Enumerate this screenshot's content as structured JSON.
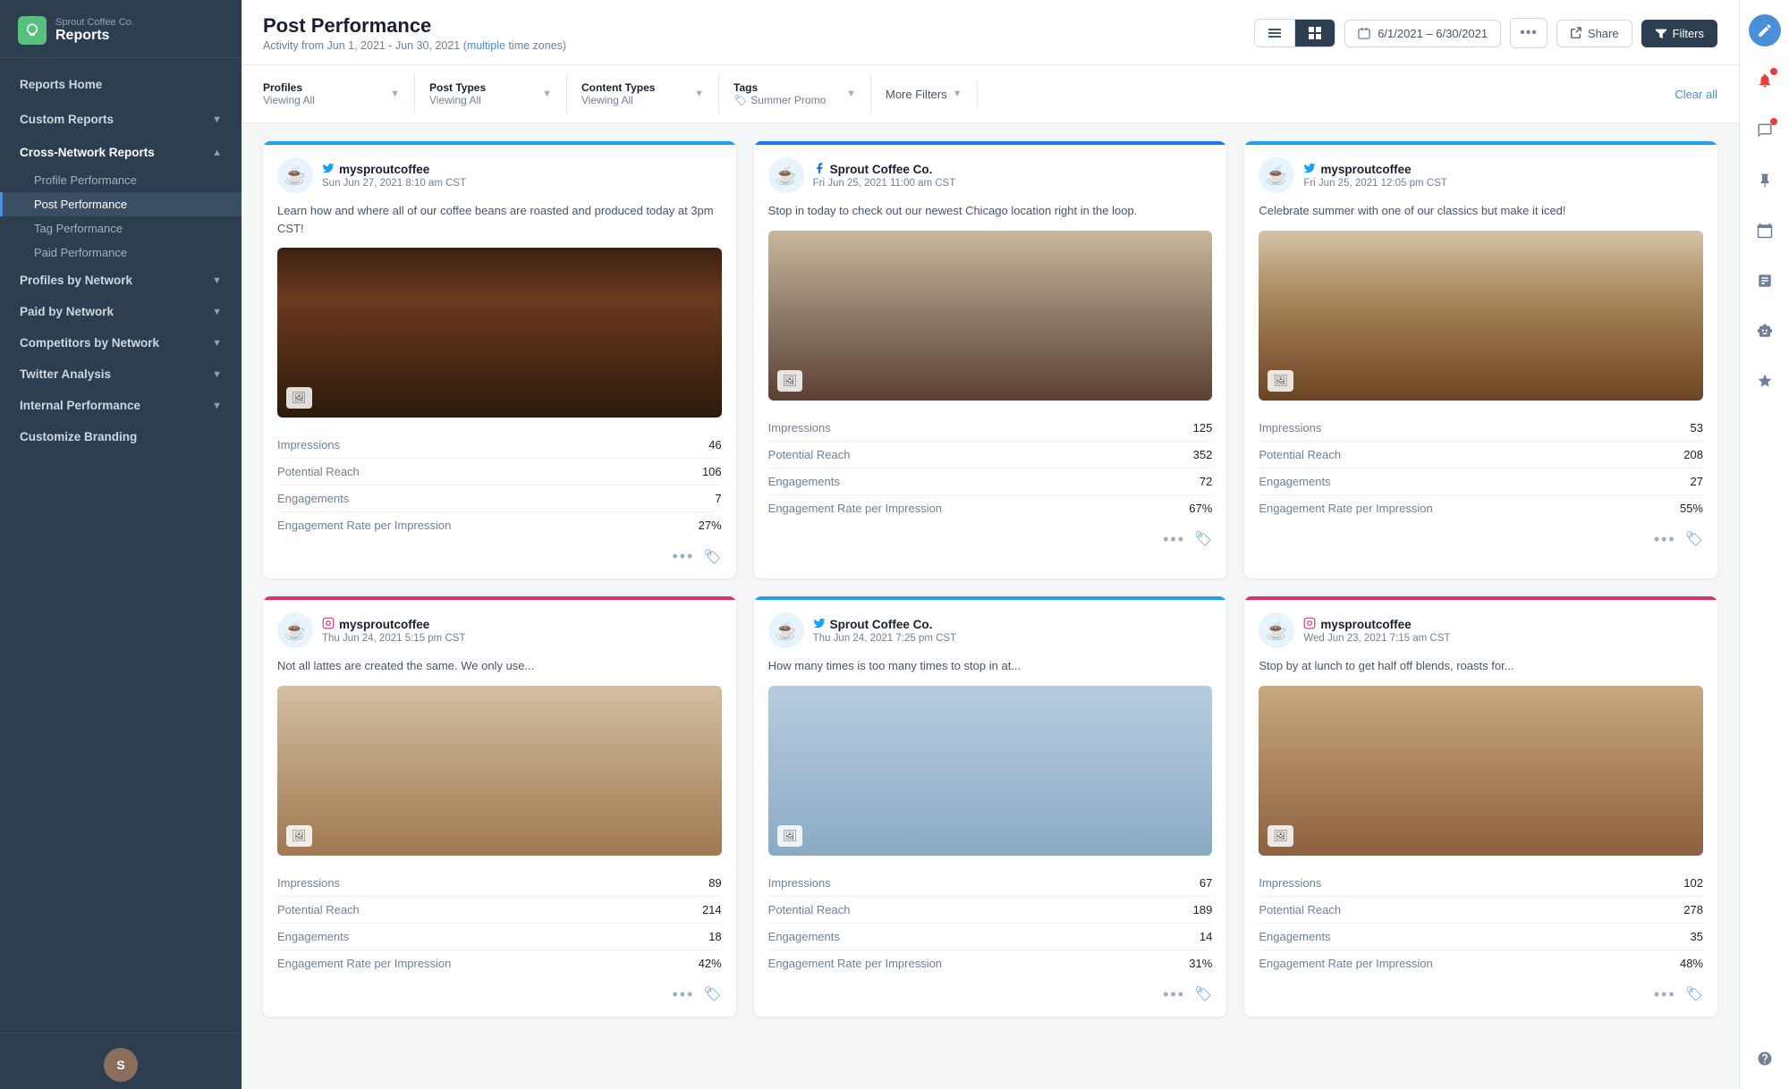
{
  "sidebar": {
    "brand": {
      "company": "Sprout Coffee Co.",
      "section": "Reports"
    },
    "nav": [
      {
        "id": "reports-home",
        "label": "Reports Home",
        "type": "top",
        "hasChevron": false
      },
      {
        "id": "custom-reports",
        "label": "Custom Reports",
        "type": "top",
        "hasChevron": true
      },
      {
        "id": "cross-network-reports",
        "label": "Cross-Network Reports",
        "type": "section",
        "hasChevron": true,
        "expanded": true
      },
      {
        "id": "profile-performance",
        "label": "Profile Performance",
        "type": "sub"
      },
      {
        "id": "post-performance",
        "label": "Post Performance",
        "type": "sub",
        "active": true
      },
      {
        "id": "tag-performance",
        "label": "Tag Performance",
        "type": "sub"
      },
      {
        "id": "paid-performance",
        "label": "Paid Performance",
        "type": "sub"
      },
      {
        "id": "profiles-by-network",
        "label": "Profiles by Network",
        "type": "section",
        "hasChevron": true
      },
      {
        "id": "paid-by-network",
        "label": "Paid by Network",
        "type": "section",
        "hasChevron": true
      },
      {
        "id": "competitors-by-network",
        "label": "Competitors by Network",
        "type": "section",
        "hasChevron": true
      },
      {
        "id": "twitter-analysis",
        "label": "Twitter Analysis",
        "type": "section",
        "hasChevron": true
      },
      {
        "id": "internal-performance",
        "label": "Internal Performance",
        "type": "section",
        "hasChevron": true
      },
      {
        "id": "customize-branding",
        "label": "Customize Branding",
        "type": "section",
        "hasChevron": false
      }
    ]
  },
  "header": {
    "title": "Post Performance",
    "subtitle": "Activity from Jun 1, 2021 - Jun 30, 2021",
    "timeZoneLink": "multiple",
    "timeZoneSuffix": "time zones)",
    "dateRange": "6/1/2021 – 6/30/2021",
    "shareLabel": "Share",
    "filtersLabel": "Filters"
  },
  "filters": {
    "profiles": {
      "label": "Profiles",
      "value": "Viewing All"
    },
    "postTypes": {
      "label": "Post Types",
      "value": "Viewing All"
    },
    "contentTypes": {
      "label": "Content Types",
      "value": "Viewing All"
    },
    "tags": {
      "label": "Tags",
      "value": "Summer Promo"
    },
    "moreFilters": {
      "label": "More Filters"
    },
    "clearAll": "Clear all"
  },
  "posts": [
    {
      "id": "post-1",
      "network": "twitter",
      "profileName": "mysproutcoffee",
      "time": "Sun Jun 27, 2021 8:10 am CST",
      "text": "Learn how and where all of our coffee beans are roasted and produced today at 3pm CST!",
      "imageType": "coffee-roaster",
      "stats": [
        {
          "label": "Impressions",
          "value": "46"
        },
        {
          "label": "Potential Reach",
          "value": "106"
        },
        {
          "label": "Engagements",
          "value": "7"
        },
        {
          "label": "Engagement Rate per Impression",
          "value": "27%"
        }
      ]
    },
    {
      "id": "post-2",
      "network": "facebook",
      "profileName": "Sprout Coffee Co.",
      "time": "Fri Jun 25, 2021 11:00 am CST",
      "text": "Stop in today to check out our newest Chicago location right in the loop.",
      "imageType": "chicago",
      "stats": [
        {
          "label": "Impressions",
          "value": "125"
        },
        {
          "label": "Potential Reach",
          "value": "352"
        },
        {
          "label": "Engagements",
          "value": "72"
        },
        {
          "label": "Engagement Rate per Impression",
          "value": "67%"
        }
      ]
    },
    {
      "id": "post-3",
      "network": "twitter",
      "profileName": "mysproutcoffee",
      "time": "Fri Jun 25, 2021 12:05 pm CST",
      "text": "Celebrate summer with one of our classics but make it iced!",
      "imageType": "iced",
      "stats": [
        {
          "label": "Impressions",
          "value": "53"
        },
        {
          "label": "Potential Reach",
          "value": "208"
        },
        {
          "label": "Engagements",
          "value": "27"
        },
        {
          "label": "Engagement Rate per Impression",
          "value": "55%"
        }
      ]
    },
    {
      "id": "post-4",
      "network": "instagram",
      "profileName": "mysproutcoffee",
      "time": "Thu Jun 24, 2021 5:15 pm CST",
      "text": "Not all lattes are created the same. We only use...",
      "imageType": "latte",
      "stats": [
        {
          "label": "Impressions",
          "value": "89"
        },
        {
          "label": "Potential Reach",
          "value": "214"
        },
        {
          "label": "Engagements",
          "value": "18"
        },
        {
          "label": "Engagement Rate per Impression",
          "value": "42%"
        }
      ]
    },
    {
      "id": "post-5",
      "network": "twitter",
      "profileName": "Sprout Coffee Co.",
      "time": "Thu Jun 24, 2021 7:25 pm CST",
      "text": "How many times is too many times to stop in at...",
      "imageType": "sprout",
      "stats": [
        {
          "label": "Impressions",
          "value": "67"
        },
        {
          "label": "Potential Reach",
          "value": "189"
        },
        {
          "label": "Engagements",
          "value": "14"
        },
        {
          "label": "Engagement Rate per Impression",
          "value": "31%"
        }
      ]
    },
    {
      "id": "post-6",
      "network": "instagram",
      "profileName": "mysproutcoffee",
      "time": "Wed Jun 23, 2021 7:15 am CST",
      "text": "Stop by at lunch to get half off blends, roasts for...",
      "imageType": "blend",
      "stats": [
        {
          "label": "Impressions",
          "value": "102"
        },
        {
          "label": "Potential Reach",
          "value": "278"
        },
        {
          "label": "Engagements",
          "value": "35"
        },
        {
          "label": "Engagement Rate per Impression",
          "value": "48%"
        }
      ]
    }
  ],
  "networkIcons": {
    "twitter": "🐦",
    "facebook": "f",
    "instagram": "📷"
  },
  "colors": {
    "twitter": "#1da1f2",
    "facebook": "#1877f2",
    "instagram": "#e1306c",
    "accent": "#4a90d9"
  }
}
